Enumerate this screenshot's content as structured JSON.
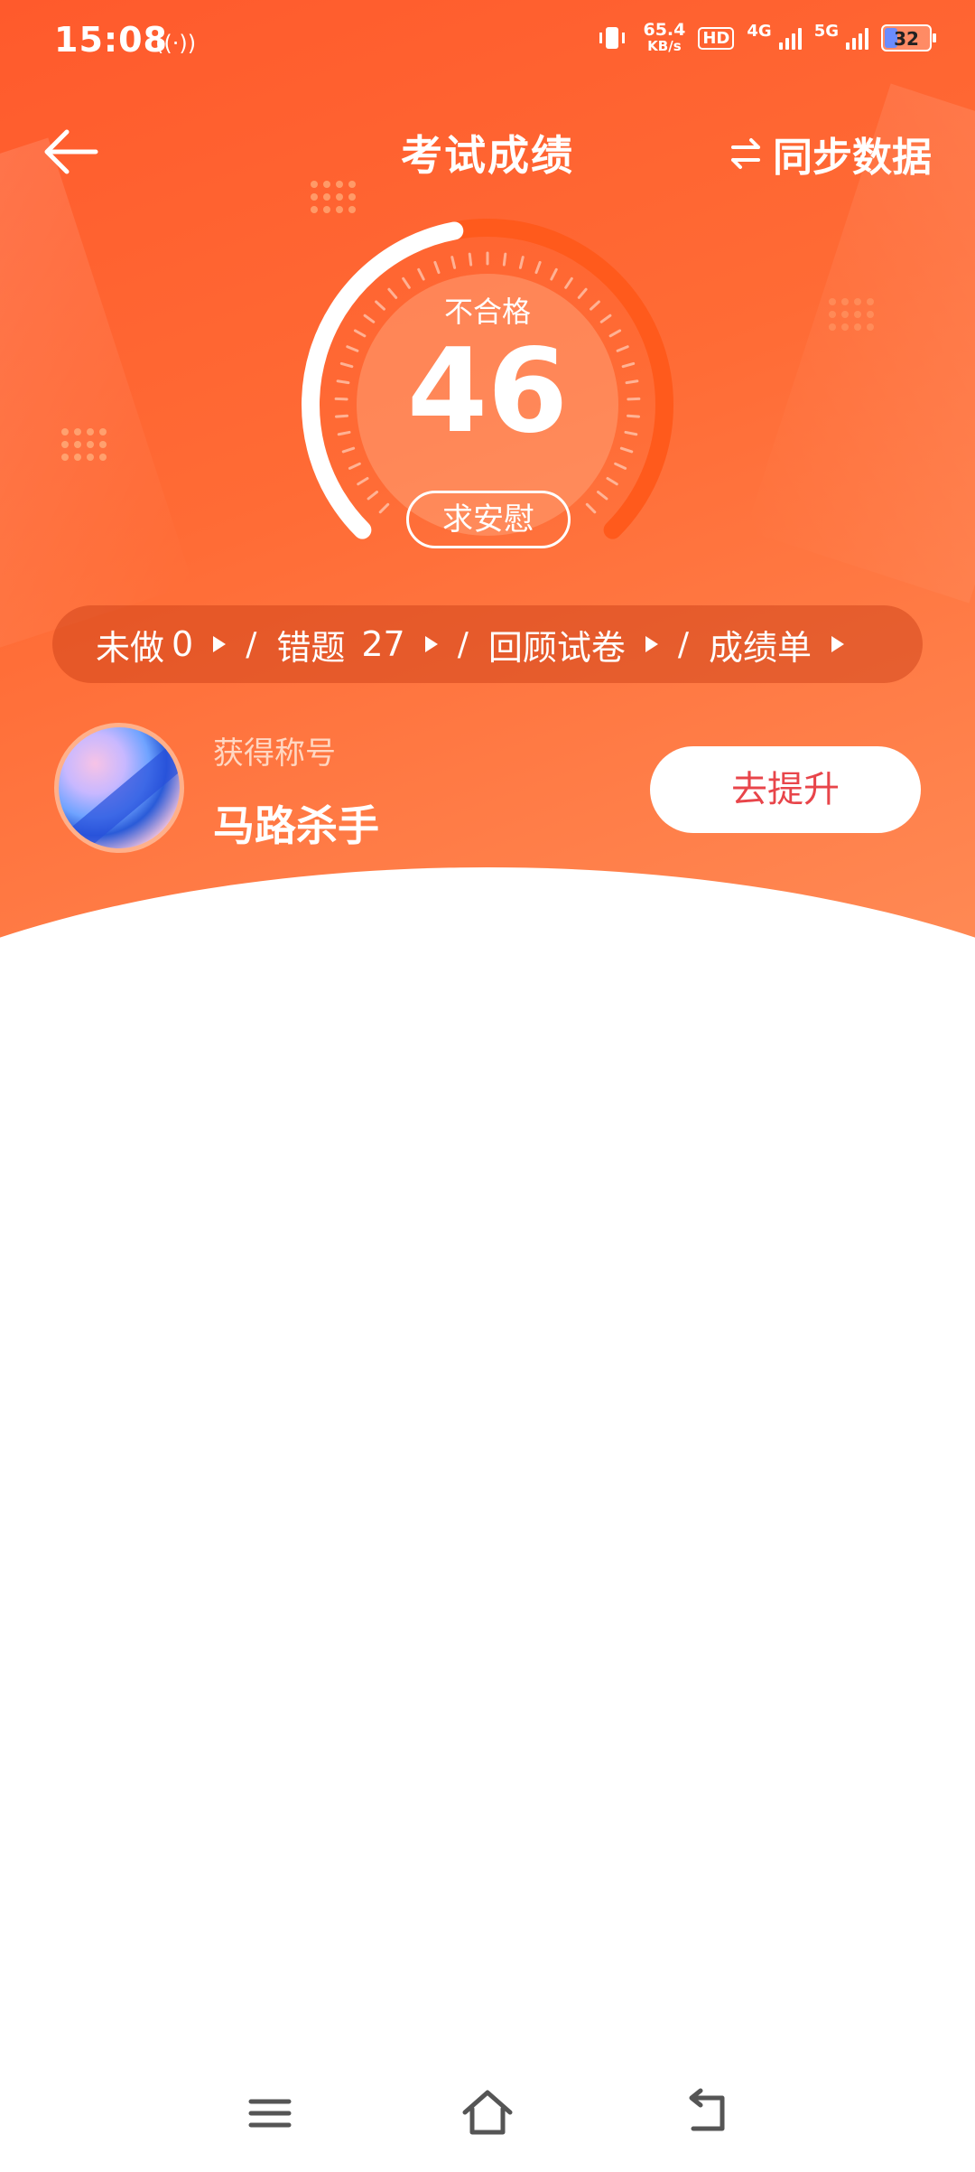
{
  "status_bar": {
    "time": "15:08",
    "nfc_icon": "((·))",
    "speed_value": "65.4",
    "speed_unit": "KB/s",
    "hd_label": "HD",
    "sim1_label": "4G",
    "sim2_label": "5G",
    "battery": "32"
  },
  "header": {
    "title": "考试成绩",
    "sync_label": "同步数据"
  },
  "result": {
    "grade": "不合格",
    "score": "46",
    "comfort_button": "求安慰",
    "score_fraction": 0.46
  },
  "stats": [
    {
      "label": "未做",
      "value": "0"
    },
    {
      "label": "错题",
      "value": "27"
    },
    {
      "label": "回顾试卷",
      "value": ""
    },
    {
      "label": "成绩单",
      "value": ""
    }
  ],
  "stats_separator": "/",
  "title_section": {
    "label": "获得称号",
    "value": "马路杀手",
    "improve_button": "去提升"
  },
  "colors": {
    "primary": "#ff6b35",
    "accent_text": "#e8454a",
    "gauge_progress": "#ffffff",
    "gauge_track": "#ff5a1c"
  },
  "navbar": {
    "icons": [
      "menu-icon",
      "home-icon",
      "back-icon"
    ]
  }
}
